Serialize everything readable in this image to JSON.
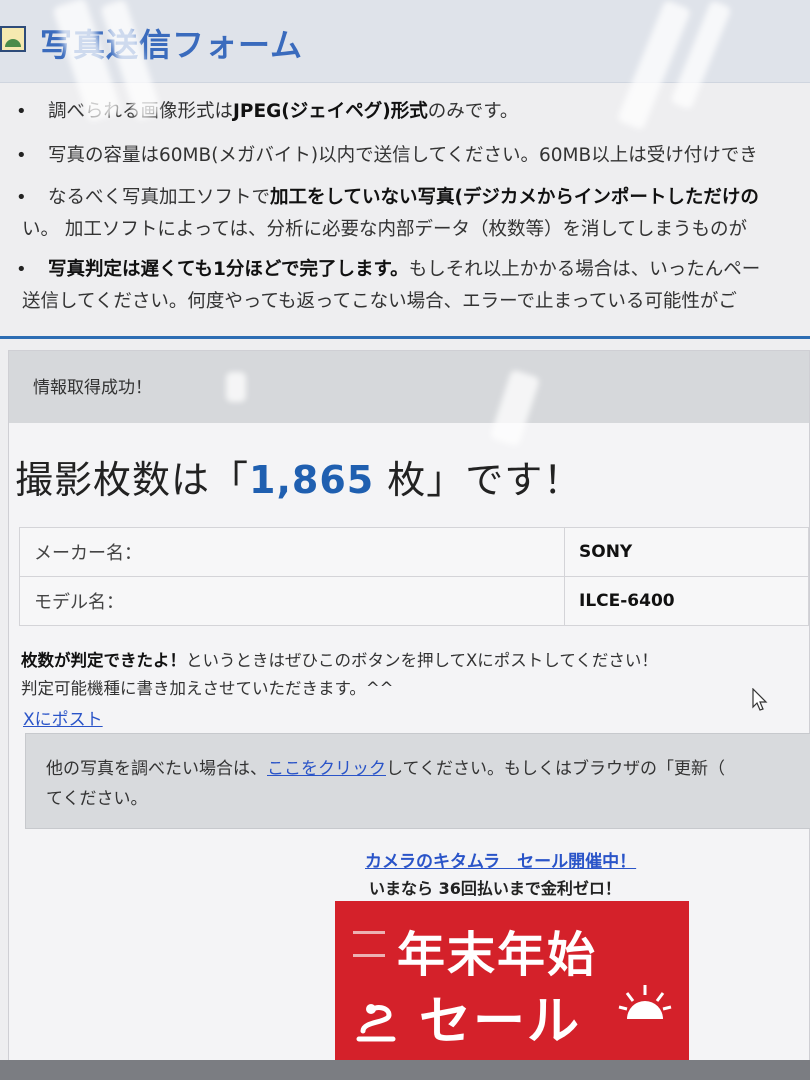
{
  "form": {
    "title": "写真送信フォーム",
    "notes": [
      {
        "pre": "調べられる画像形式は",
        "bold": "JPEG(ジェイペグ)形式",
        "post": "のみです。"
      },
      {
        "text": "写真の容量は60MB(メガバイト)以内で送信してください。60MB以上は受け付けでき"
      },
      {
        "pre": "なるべく写真加工ソフトで",
        "bold": "加工をしていない写真(デジカメからインポートしただけの",
        "post": "",
        "line2": "い。 加工ソフトによっては、分析に必要な内部データ（枚数等）を消してしまうものが"
      },
      {
        "bold": "写真判定は遅くても1分ほどで完了します。",
        "post": "もしそれ以上かかる場合は、いったんペー",
        "line2": "送信してください。何度やっても返ってこない場合、エラーで止まっている可能性がご"
      }
    ]
  },
  "result": {
    "status": "情報取得成功！",
    "count_prefix": "撮影枚数は「",
    "count_value": "1,865",
    "count_suffix": " 枚」です！",
    "table": [
      {
        "label": "メーカー名：",
        "value": "SONY"
      },
      {
        "label": "モデル名：",
        "value": "ILCE-6400"
      }
    ],
    "post_bold": "枚数が判定できたよ！",
    "post_rest": "というときはぜひこのボタンを押してXにポストしてください！",
    "post_line2": "判定可能機種に書き加えさせていただきます。^^",
    "post_link": "Xにポスト",
    "other_pre": "他の写真を調べたい場合は、",
    "other_link": "ここをクリック",
    "other_post": "してください。もしくはブラウザの「更新（",
    "other_line2": "てください。"
  },
  "ad": {
    "link": "カメラのキタムラ　セール開催中！",
    "sub": "いまなら 36回払いまで金利ゼロ！",
    "banner_line1": "年末年始",
    "banner_line2": "セール"
  },
  "icons": [
    "image-icon",
    "snake-icon",
    "sun-icon",
    "cursor-icon"
  ],
  "colors": {
    "title": "#3a6bbd",
    "count": "#1f5fb0",
    "link": "#2a54c8",
    "banner": "#d4212a"
  }
}
